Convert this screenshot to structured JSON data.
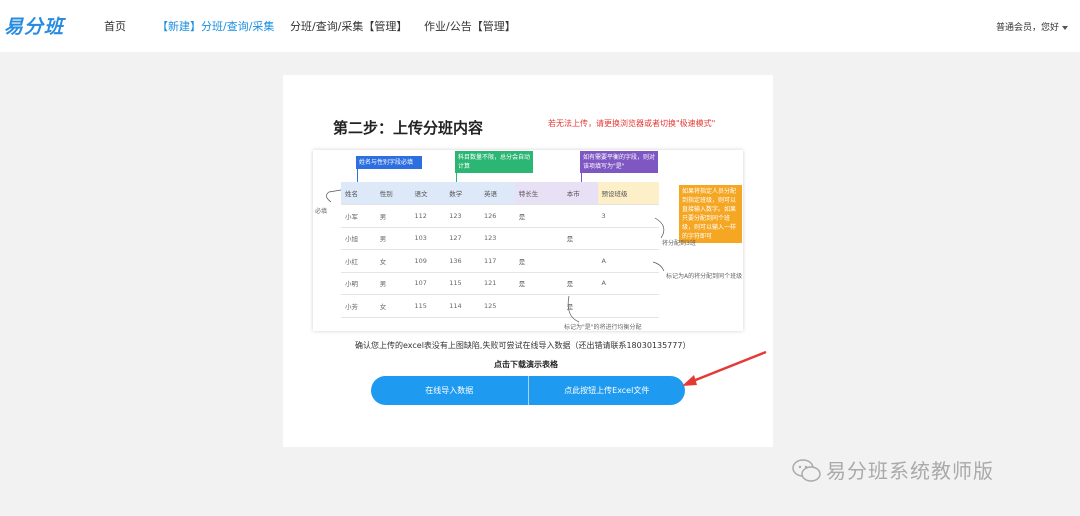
{
  "header": {
    "logo": "易分班",
    "nav": [
      {
        "label": "首页"
      },
      {
        "label": "【新建】分班/查询/采集"
      },
      {
        "label": "分班/查询/采集【管理】"
      },
      {
        "label": "作业/公告【管理】"
      }
    ],
    "user": "普通会员，您好"
  },
  "card": {
    "title": "第二步：上传分班内容",
    "warning": "若无法上传，请更换浏览器或者切换\"极速模式\"",
    "callouts": {
      "name_gender": "姓名与性别字段必填",
      "subjects": "科目数量不限，总分会自动计算",
      "balance": "如有需要平衡的字段，则对该项填写为\"是\"",
      "preassign": "如果将指定人员分配到指定班级，则可以直接输入数字。如果只要分配到同个班级，则可以输入一样的字符即可"
    },
    "notes": {
      "required": "必填",
      "assign_class": "将分配到3班",
      "same_class": "标记为A的将分配到同个班级",
      "balanced": "标记为\"是\"的将进行均衡分配"
    },
    "table": {
      "headers": [
        "姓名",
        "性别",
        "语文",
        "数学",
        "英语",
        "特长生",
        "本市",
        "预设班级"
      ],
      "rows": [
        [
          "小军",
          "男",
          "112",
          "123",
          "126",
          "是",
          "",
          "3"
        ],
        [
          "小旭",
          "男",
          "103",
          "127",
          "123",
          "",
          "是",
          ""
        ],
        [
          "小红",
          "女",
          "109",
          "136",
          "117",
          "是",
          "",
          "A"
        ],
        [
          "小明",
          "男",
          "107",
          "115",
          "121",
          "是",
          "是",
          "A"
        ],
        [
          "小芳",
          "女",
          "115",
          "114",
          "125",
          "",
          "是",
          ""
        ]
      ]
    },
    "confirm_text": "确认您上传的excel表没有上图缺陷,失败可尝试在线导入数据（还出错请联系18030135777）",
    "download_link": "点击下载演示表格",
    "buttons": {
      "online_import": "在线导入数据",
      "upload_excel": "点此按钮上传Excel文件"
    }
  },
  "watermark": "易分班系统教师版",
  "colors": {
    "accent": "#1e9bf0",
    "nav_active": "#1b8fe0",
    "warning": "#e53935",
    "callout_blue": "#2d6fe0",
    "callout_green": "#2bb673",
    "callout_purple": "#7e57c2",
    "callout_orange": "#f5a623",
    "arrow": "#e53935"
  },
  "icons": [
    "caret-down-icon",
    "wechat-icon",
    "red-arrow-icon"
  ]
}
